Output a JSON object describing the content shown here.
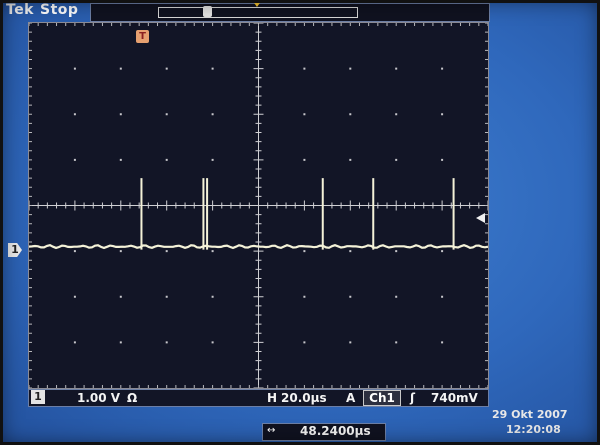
{
  "header": {
    "brand": "Tek",
    "acquisition_state": "Stop"
  },
  "channel": {
    "number": "1",
    "vertical_scale": "1.00 V",
    "coupling_symbol": "Ω",
    "marker_label": "1"
  },
  "timebase": {
    "label": "H",
    "scale": "20.0µs"
  },
  "trigger": {
    "mode_label": "A",
    "source": "Ch1",
    "slope_symbol": "ʃ",
    "level": "740mV",
    "marker_label": "T"
  },
  "horizontal_position": {
    "icon": "↔",
    "value": "48.2400µs"
  },
  "clock": {
    "date": "29 Okt  2007",
    "time": "12:20:08"
  },
  "colors": {
    "screen_blue": "#3a78cc",
    "graticule_bg": "#121526",
    "trace": "#f4f2d8",
    "trigger_marker": "#e6a070"
  },
  "waveform": {
    "baseline_div": -0.9,
    "spike_height_div": 1.5,
    "spike_times_div": [
      -2.55,
      -1.2,
      -1.12,
      1.4,
      2.5,
      4.25
    ]
  }
}
